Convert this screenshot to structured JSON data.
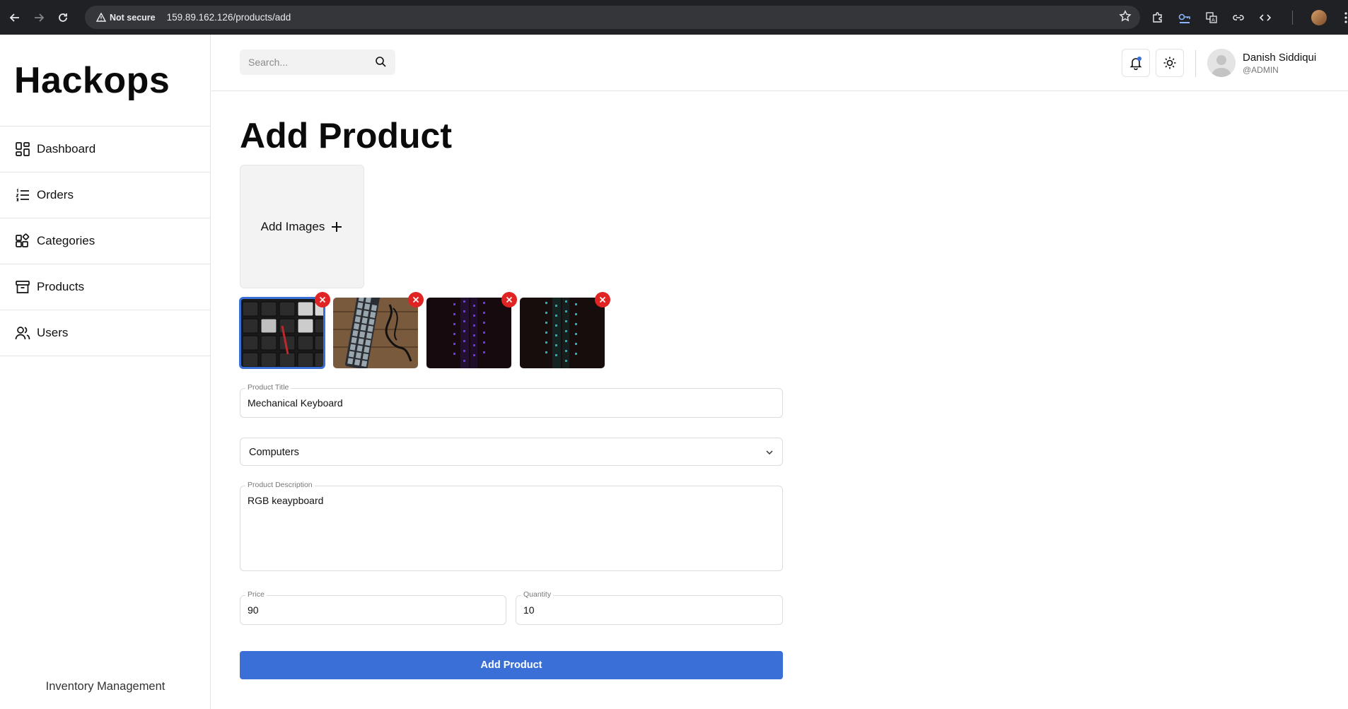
{
  "browser": {
    "security_label": "Not secure",
    "url": "159.89.162.126/products/add"
  },
  "sidebar": {
    "brand": "Hackops",
    "items": [
      {
        "label": "Dashboard",
        "icon": "dashboard-icon"
      },
      {
        "label": "Orders",
        "icon": "list-icon"
      },
      {
        "label": "Categories",
        "icon": "categories-icon"
      },
      {
        "label": "Products",
        "icon": "archive-box-icon"
      },
      {
        "label": "Users",
        "icon": "users-icon"
      }
    ],
    "footer": "Inventory Management"
  },
  "header": {
    "search_placeholder": "Search...",
    "user": {
      "name": "Danish Siddiqui",
      "role": "@ADMIN"
    },
    "notification_dot_color": "#3a6fd8"
  },
  "main": {
    "title": "Add Product",
    "add_images_label": "Add Images",
    "thumbnails": [
      {
        "alt": "keyboard-keys-red-logo",
        "selected": true
      },
      {
        "alt": "keyboard-on-wood-with-cable",
        "selected": false
      },
      {
        "alt": "keyboard-purple-backlight",
        "selected": false
      },
      {
        "alt": "keyboard-cyan-backlight",
        "selected": false
      }
    ],
    "product_title": {
      "label": "Product Title",
      "value": "Mechanical Keyboard"
    },
    "category": {
      "value": "Computers"
    },
    "description": {
      "label": "Product Description",
      "value": "RGB keaypboard"
    },
    "price": {
      "label": "Price",
      "value": "90"
    },
    "quantity": {
      "label": "Quantity",
      "value": "10"
    },
    "submit_label": "Add Product"
  },
  "colors": {
    "accent": "#3a6fd8",
    "remove": "#e02424"
  }
}
